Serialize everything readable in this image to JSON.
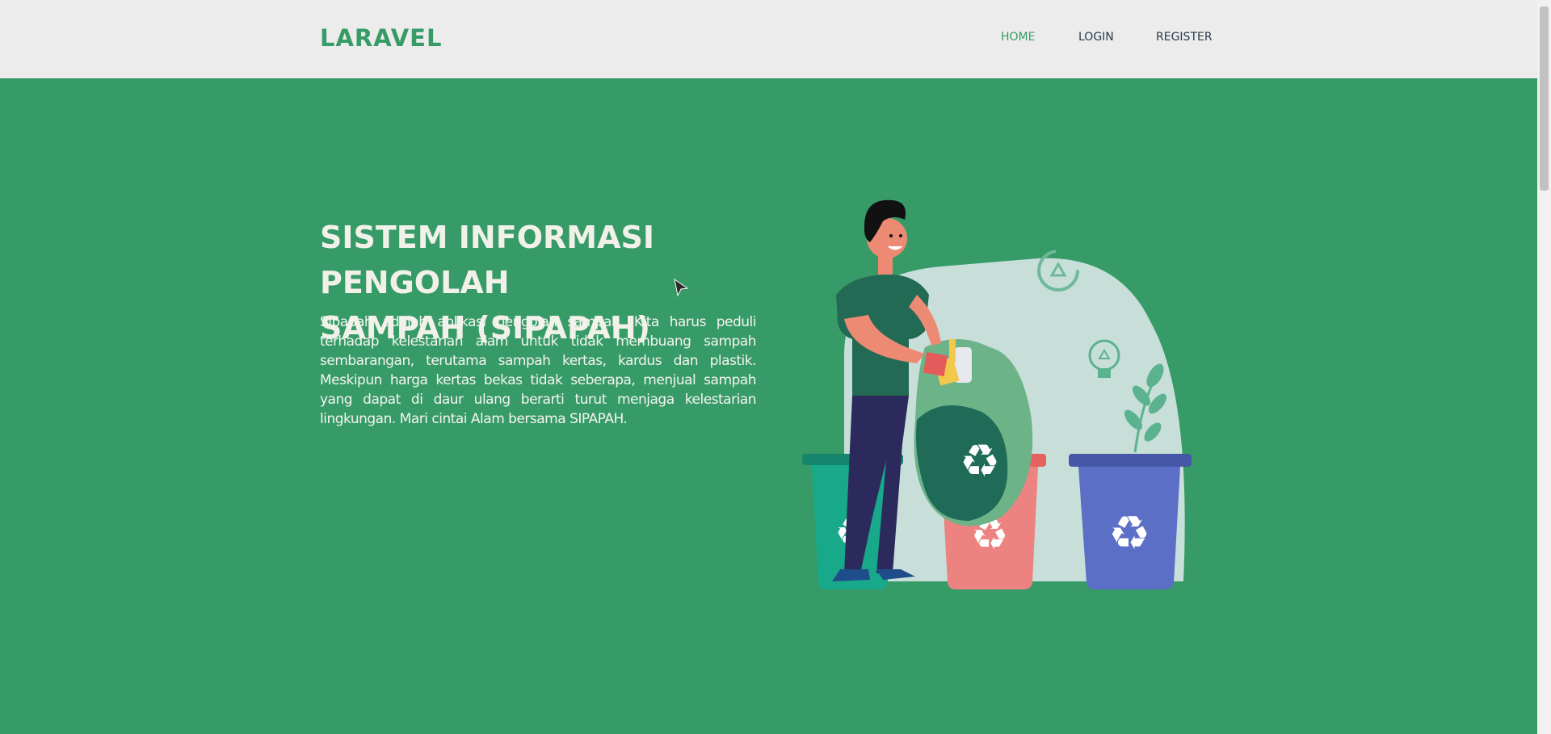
{
  "navbar": {
    "brand": "LARAVEL",
    "links": [
      {
        "label": "HOME",
        "active": true
      },
      {
        "label": "LOGIN",
        "active": false
      },
      {
        "label": "REGISTER",
        "active": false
      }
    ]
  },
  "hero": {
    "title_line1": "SISTEM INFORMASI PENGOLAH",
    "title_line2": "SAMPAH (SIPAPAH)",
    "description": "Sipapah adalah aplikasi pengolah sampah. Kita harus peduli terhadap kelestarian alam untuk tidak membuang sampah sembarangan, terutama sampah kertas, kardus dan plastik. Meskipun harga kertas bekas tidak seberapa, menjual sampah yang dapat di daur ulang berarti turut menjaga kelestarian lingkungan. Mari cintai Alam bersama SIPAPAH."
  },
  "colors": {
    "brand_green": "#379b67",
    "navbar_bg": "#ececec",
    "bin_teal": "#17a98a",
    "bin_red": "#ec8380",
    "bin_blue": "#5b6fc6"
  }
}
